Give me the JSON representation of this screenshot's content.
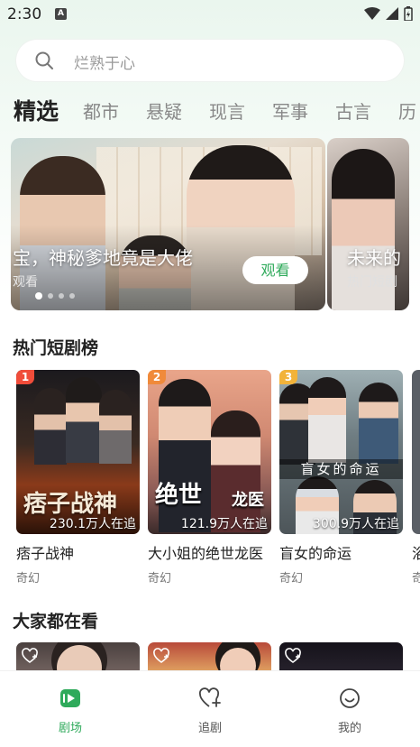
{
  "status_bar": {
    "time": "2:30",
    "badge": "A"
  },
  "search": {
    "placeholder": "烂熟于心"
  },
  "tabs": [
    "精选",
    "都市",
    "悬疑",
    "现言",
    "军事",
    "古言",
    "历"
  ],
  "banner": {
    "main": {
      "title": "宝，神秘爹地竟是大佬",
      "subtitle": "观看",
      "button": "观看"
    },
    "next": {
      "title": "未来的",
      "subtitle": "热门短剧"
    }
  },
  "hot_section": {
    "title": "热门短剧榜",
    "items": [
      {
        "rank": "1",
        "title": "痞子战神",
        "genre": "奇幻",
        "watchers": "230.1万人在追",
        "poster_text": "痞子战神",
        "rank_color": "#f04d3a"
      },
      {
        "rank": "2",
        "title": "大小姐的绝世龙医",
        "genre": "奇幻",
        "watchers": "121.9万人在追",
        "poster_text": "绝世",
        "poster_text2": "龙医",
        "rank_color": "#f08a3a"
      },
      {
        "rank": "3",
        "title": "盲女的命运",
        "genre": "奇幻",
        "watchers": "300.9万人在追",
        "poster_text": "盲女的命运",
        "rank_color": "#f2b33a"
      }
    ],
    "peek": {
      "title": "浴",
      "genre": "奇"
    }
  },
  "everyone_section": {
    "title": "大家都在看"
  },
  "bottom_nav": [
    {
      "label": "剧场",
      "icon": "theater-icon",
      "active": true
    },
    {
      "label": "追剧",
      "icon": "heart-plus-icon",
      "active": false
    },
    {
      "label": "我的",
      "icon": "profile-smile-icon",
      "active": false
    }
  ],
  "colors": {
    "accent": "#2faa5b",
    "highlight": "#c4efd2"
  }
}
